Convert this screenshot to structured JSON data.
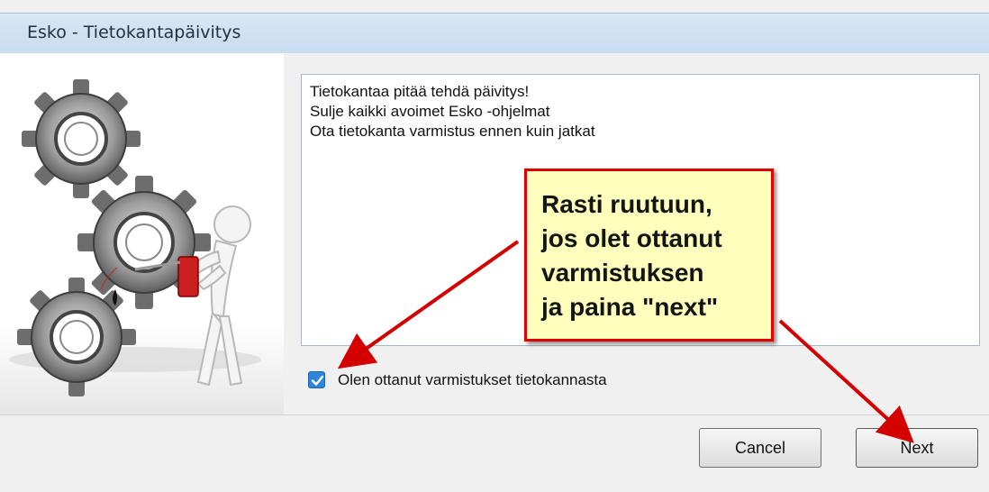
{
  "window": {
    "title": "Esko - Tietokantapäivitys"
  },
  "message": {
    "lines": [
      "Tietokantaa pitää tehdä päivitys!",
      "Sulje kaikki avoimet Esko -ohjelmat",
      "Ota tietokanta varmistus ennen kuin jatkat"
    ]
  },
  "backup_checkbox": {
    "label": "Olen ottanut varmistukset tietokannasta",
    "checked": true
  },
  "buttons": {
    "cancel_label": "Cancel",
    "next_label": "Next"
  },
  "callout": {
    "lines": [
      "Rasti ruutuun,",
      "jos olet ottanut",
      "varmistuksen",
      "ja paina \"next\""
    ]
  },
  "colors": {
    "arrow": "#d40000",
    "callout_border": "#e00000",
    "callout_bg": "#ffffbd",
    "checkbox_fill": "#2f86d8"
  },
  "icons": {
    "illustration": "gears-figure-oil-can-illustration",
    "checkbox": "checkmark-icon"
  }
}
